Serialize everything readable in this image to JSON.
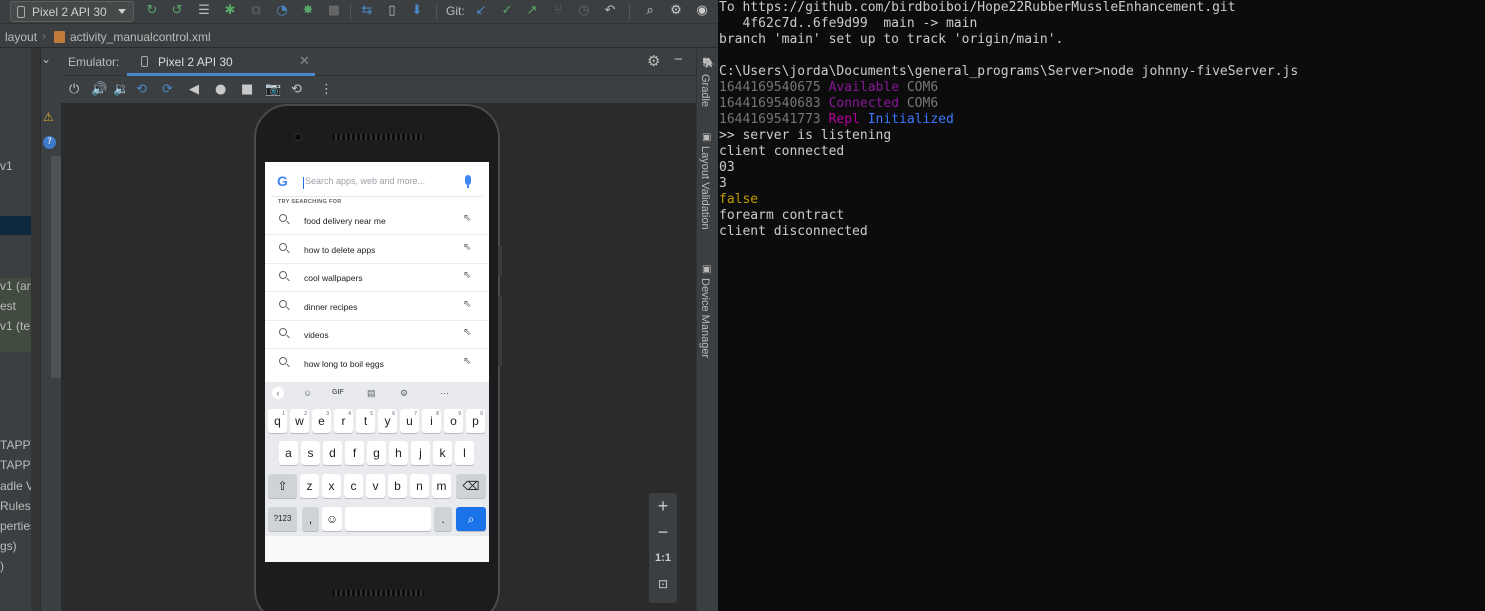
{
  "ide": {
    "toolbar": {
      "device_selector": "Pixel 2 API 30",
      "git_label": "Git:"
    },
    "breadcrumb": {
      "items": [
        "layout",
        "activity_manualcontrol.xml"
      ]
    },
    "project_panel": {
      "fragments": [
        "v1",
        "v1 (an",
        "est",
        "v1 (te",
        "TAPPV",
        "TAPPV",
        "adle V",
        "Rules",
        "perties",
        "gs)",
        ")"
      ]
    },
    "emulator": {
      "label": "Emulator:",
      "tab_title": "Pixel 2 API 30"
    },
    "right_tabs": [
      "Gradle",
      "Layout Validation",
      "Device Manager"
    ],
    "zoom": {
      "plus": "+",
      "minus": "−",
      "reset": "1:1"
    }
  },
  "phone_screen": {
    "search": {
      "placeholder": "Search apps, web and more...",
      "google_letter": "G"
    },
    "try_label": "TRY SEARCHING FOR",
    "suggestions": [
      "food delivery near me",
      "how to delete apps",
      "cool wallpapers",
      "dinner recipes",
      "videos",
      "how long to boil eggs"
    ],
    "keyboard": {
      "strip_gif": "GIF",
      "row1": [
        "q",
        "w",
        "e",
        "r",
        "t",
        "y",
        "u",
        "i",
        "o",
        "p"
      ],
      "row1_hints": [
        "1",
        "2",
        "3",
        "4",
        "5",
        "6",
        "7",
        "8",
        "9",
        "0"
      ],
      "row2": [
        "a",
        "s",
        "d",
        "f",
        "g",
        "h",
        "j",
        "k",
        "l"
      ],
      "row3": [
        "z",
        "x",
        "c",
        "v",
        "b",
        "n",
        "m"
      ],
      "symbols_key": "?123",
      "comma_key": ",",
      "period_key": "."
    }
  },
  "terminal": {
    "lines": [
      {
        "segments": [
          {
            "text": "To https://github.com/birdboiboi/Hope22RubberMussleEnhancement.git",
            "color": "default"
          }
        ]
      },
      {
        "segments": [
          {
            "text": "   4f62c7d..6fe9d99  main -> main",
            "color": "default"
          }
        ]
      },
      {
        "segments": [
          {
            "text": "branch 'main' set up to track 'origin/main'.",
            "color": "default"
          }
        ]
      },
      {
        "segments": [
          {
            "text": "",
            "color": "default"
          }
        ]
      },
      {
        "segments": [
          {
            "text": "C:\\Users\\jorda\\Documents\\general_programs\\Server>node johnny-fiveServer.js",
            "color": "default"
          }
        ]
      },
      {
        "segments": [
          {
            "text": "1644169540675 ",
            "color": "gray"
          },
          {
            "text": "Available",
            "color": "purple"
          },
          {
            "text": " COM6",
            "color": "gray"
          }
        ]
      },
      {
        "segments": [
          {
            "text": "1644169540683 ",
            "color": "gray"
          },
          {
            "text": "Connected",
            "color": "purple"
          },
          {
            "text": " COM6",
            "color": "gray"
          }
        ]
      },
      {
        "segments": [
          {
            "text": "1644169541773 ",
            "color": "gray"
          },
          {
            "text": "Repl",
            "color": "purple2"
          },
          {
            "text": " ",
            "color": "default"
          },
          {
            "text": "Initialized",
            "color": "blue"
          }
        ]
      },
      {
        "segments": [
          {
            "text": ">> server is listening",
            "color": "default"
          }
        ]
      },
      {
        "segments": [
          {
            "text": "client connected",
            "color": "default"
          }
        ]
      },
      {
        "segments": [
          {
            "text": "03",
            "color": "default"
          }
        ]
      },
      {
        "segments": [
          {
            "text": "3",
            "color": "default"
          }
        ]
      },
      {
        "segments": [
          {
            "text": "false",
            "color": "yellow"
          }
        ]
      },
      {
        "segments": [
          {
            "text": "forearm contract",
            "color": "default"
          }
        ]
      },
      {
        "segments": [
          {
            "text": "client disconnected",
            "color": "default"
          }
        ]
      }
    ]
  },
  "colors": {
    "ide_background": "#3c3f41",
    "editor_background": "#2b2b2b",
    "terminal_background": "#0c0c0c",
    "accent_blue": "#4a88c7",
    "keyboard_search_key": "#1a73e8"
  }
}
